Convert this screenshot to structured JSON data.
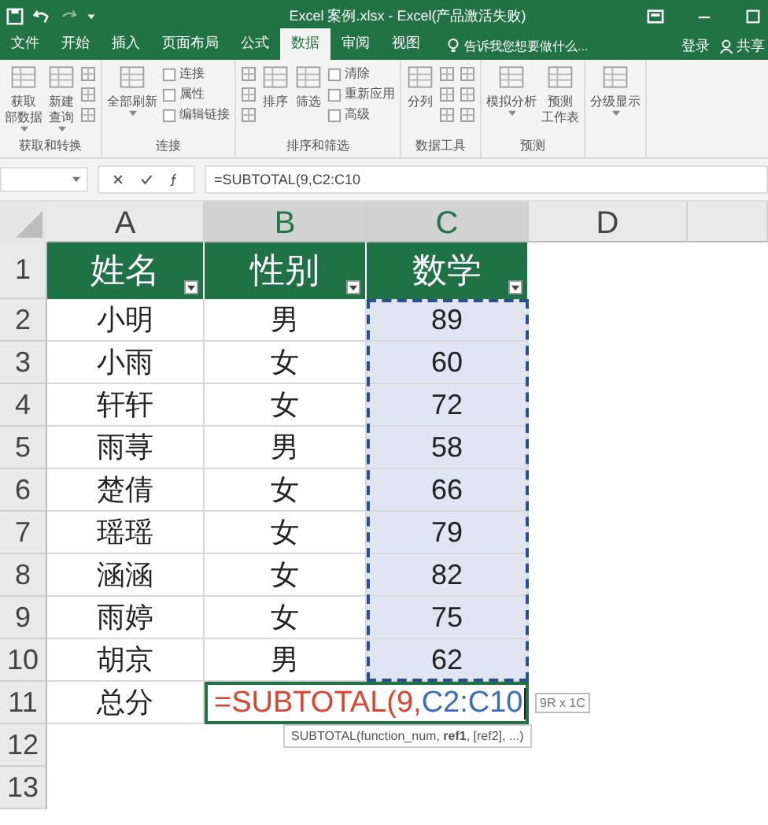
{
  "window": {
    "title": "Excel 案例.xlsx - Excel(产品激活失败)"
  },
  "tabs": [
    {
      "label": "文件",
      "selected": false
    },
    {
      "label": "开始",
      "selected": false
    },
    {
      "label": "插入",
      "selected": false
    },
    {
      "label": "页面布局",
      "selected": false
    },
    {
      "label": "公式",
      "selected": false
    },
    {
      "label": "数据",
      "selected": true
    },
    {
      "label": "审阅",
      "selected": false
    },
    {
      "label": "视图",
      "selected": false
    }
  ],
  "tell_me": {
    "placeholder": "告诉我您想要做什么..."
  },
  "account": {
    "sign_in": "登录",
    "share": "共享"
  },
  "ribbon_groups": [
    {
      "label": "获取和转换",
      "items": [
        {
          "kind": "large",
          "lines": [
            "获取",
            "部数据"
          ],
          "dropdown": true
        },
        {
          "kind": "large",
          "lines": [
            "新建",
            "查询"
          ],
          "dropdown": true
        },
        {
          "kind": "icons"
        }
      ]
    },
    {
      "label": "连接",
      "items": [
        {
          "kind": "large",
          "lines": [
            "全部刷新"
          ],
          "dropdown": true
        },
        {
          "kind": "small",
          "labels": [
            "连接",
            "属性",
            "编辑链接"
          ]
        }
      ]
    },
    {
      "label": "排序和筛选",
      "items": [
        {
          "kind": "icons"
        },
        {
          "kind": "large",
          "lines": [
            "排序"
          ],
          "dropdown": false
        },
        {
          "kind": "large",
          "lines": [
            "筛选"
          ],
          "dropdown": false
        },
        {
          "kind": "small",
          "labels": [
            "清除",
            "重新应用",
            "高级"
          ]
        }
      ]
    },
    {
      "label": "数据工具",
      "items": [
        {
          "kind": "large",
          "lines": [
            "分列"
          ],
          "dropdown": false
        },
        {
          "kind": "icons"
        },
        {
          "kind": "icons"
        }
      ]
    },
    {
      "label": "预测",
      "items": [
        {
          "kind": "large",
          "lines": [
            "模拟分析"
          ],
          "dropdown": true
        },
        {
          "kind": "large",
          "lines": [
            "预测",
            "工作表"
          ],
          "dropdown": false
        }
      ]
    },
    {
      "items": [
        {
          "kind": "large",
          "lines": [
            "分级显示"
          ],
          "dropdown": true
        }
      ]
    }
  ],
  "formula_bar": {
    "value": "=SUBTOTAL(9,C2:C10"
  },
  "columns": [
    {
      "label": "A",
      "selected": false
    },
    {
      "label": "B",
      "selected": true
    },
    {
      "label": "C",
      "selected": true
    },
    {
      "label": "D",
      "selected": false
    }
  ],
  "row_numbers": [
    "1",
    "2",
    "3",
    "4",
    "5",
    "6",
    "7",
    "8",
    "9",
    "10",
    "11",
    "12",
    "13"
  ],
  "sheet": {
    "headers": [
      "姓名",
      "性别",
      "数学"
    ],
    "rows": [
      [
        "小明",
        "男",
        "89"
      ],
      [
        "小雨",
        "女",
        "60"
      ],
      [
        "轩轩",
        "女",
        "72"
      ],
      [
        "雨荨",
        "男",
        "58"
      ],
      [
        "楚倩",
        "女",
        "66"
      ],
      [
        "瑶瑶",
        "女",
        "79"
      ],
      [
        "涵涵",
        "女",
        "82"
      ],
      [
        "雨婷",
        "女",
        "75"
      ],
      [
        "胡京",
        "男",
        "62"
      ]
    ],
    "total_label": "总分"
  },
  "edit_cell": {
    "parts": [
      {
        "text": "=SUBTOTAL(9,",
        "color": "#d9452f"
      },
      {
        "text": "C2:C10",
        "color": "#3b6dbf"
      }
    ]
  },
  "range_size": "9R x 1C",
  "tooltip": "SUBTOTAL(function_num, **ref1**, [ref2], ...)"
}
